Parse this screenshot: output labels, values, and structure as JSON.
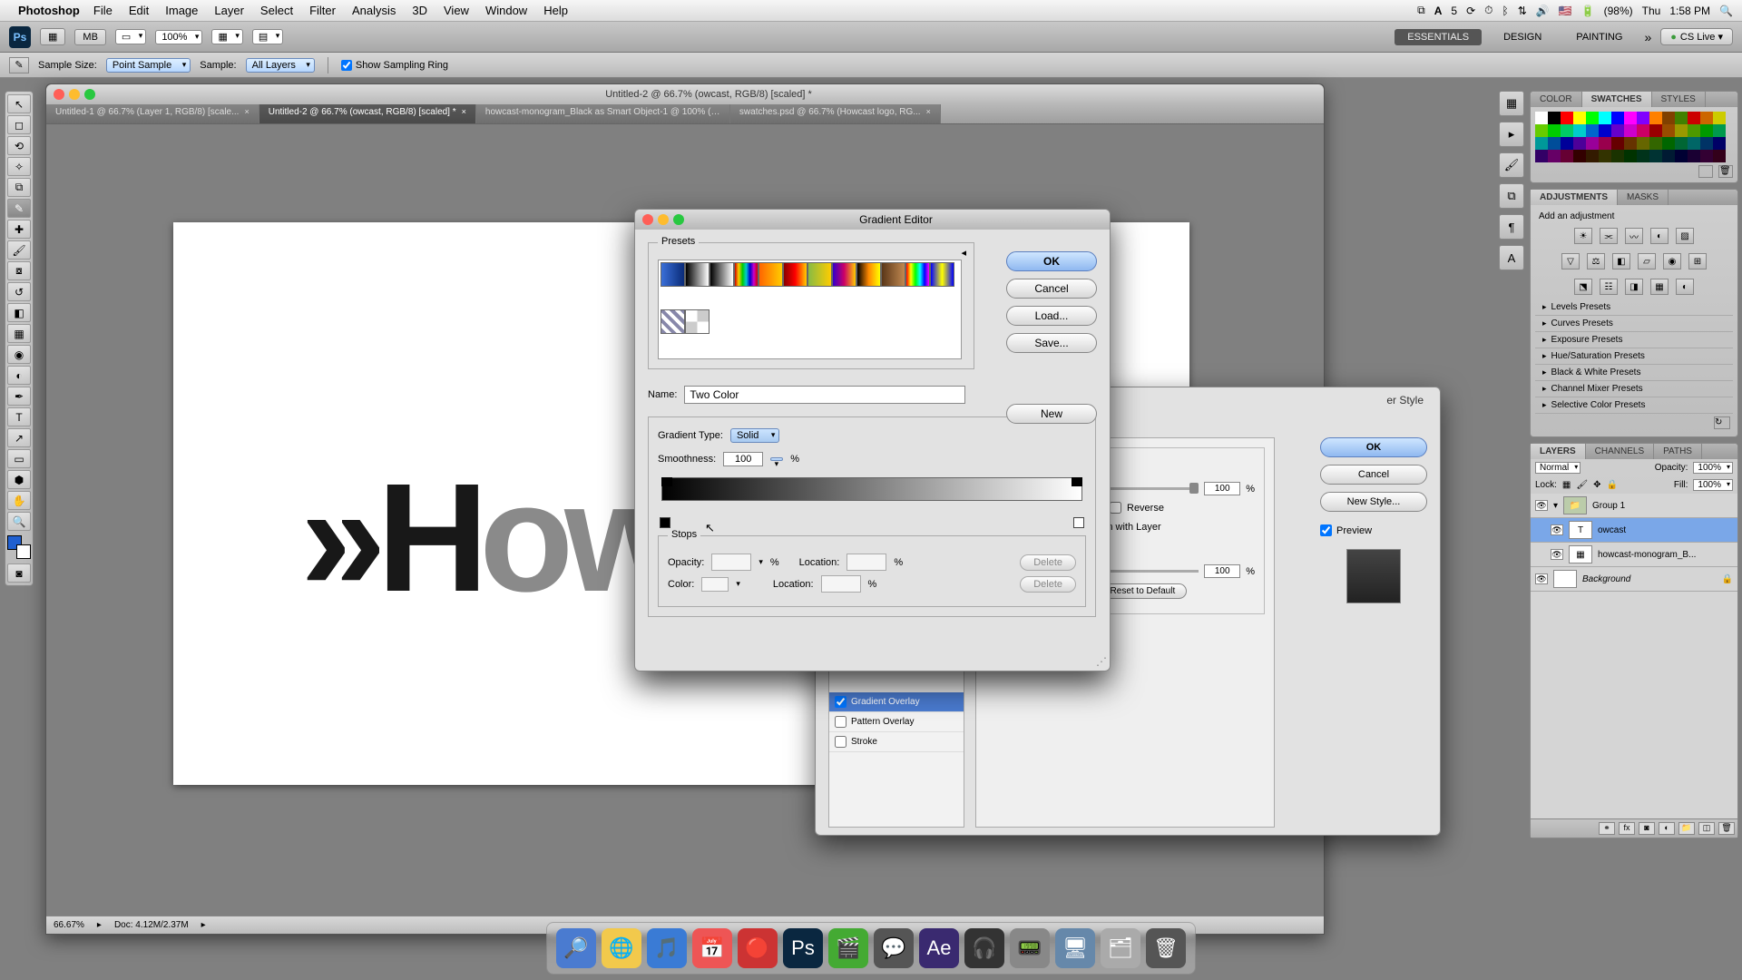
{
  "menubar": {
    "app": "Photoshop",
    "items": [
      "File",
      "Edit",
      "Image",
      "Layer",
      "Select",
      "Filter",
      "Analysis",
      "3D",
      "View",
      "Window",
      "Help"
    ],
    "right": {
      "battery": "(98%)",
      "day": "Thu",
      "time": "1:58 PM",
      "adobe": "5"
    }
  },
  "appbar": {
    "zoom": "100%",
    "tabs": {
      "essentials": "ESSENTIALS",
      "design": "DESIGN",
      "painting": "PAINTING"
    },
    "cslive": "CS Live"
  },
  "optbar": {
    "sample_size_label": "Sample Size:",
    "sample_size": "Point Sample",
    "sample_label": "Sample:",
    "sample": "All Layers",
    "show_ring": "Show Sampling Ring"
  },
  "docwin": {
    "title": "Untitled-2 @ 66.7% (owcast, RGB/8) [scaled] *",
    "tabs": [
      "Untitled-1 @ 66.7% (Layer 1, RGB/8) [scale...",
      "Untitled-2 @ 66.7% (owcast, RGB/8) [scaled] *",
      "howcast-monogram_Black as Smart Object-1 @ 100% (howcast-mon...",
      "swatches.psd @ 66.7% (Howcast logo, RG..."
    ],
    "status": {
      "zoom": "66.67%",
      "doc": "Doc: 4.12M/2.37M"
    }
  },
  "layerstyle": {
    "title": "er Style",
    "left": {
      "gradient_overlay": "Gradient Overlay",
      "pattern_overlay": "Pattern Overlay",
      "stroke": "Stroke"
    },
    "ok": "OK",
    "cancel": "Cancel",
    "newstyle": "New Style...",
    "preview": "Preview",
    "center": {
      "reverse": "Reverse",
      "align": "Align with Layer",
      "scale": "100",
      "angle": "100",
      "resetdef": "Reset to Default",
      "deg": "°",
      "pct": "%"
    }
  },
  "gradedit": {
    "title": "Gradient Editor",
    "presets": "Presets",
    "ok": "OK",
    "cancel": "Cancel",
    "load": "Load...",
    "save": "Save...",
    "new": "New",
    "name_label": "Name:",
    "name": "Two Color",
    "type_label": "Gradient Type:",
    "type": "Solid",
    "smooth_label": "Smoothness:",
    "smooth": "100",
    "pct": "%",
    "stops": "Stops",
    "opacity_label": "Opacity:",
    "location_label": "Location:",
    "color_label": "Color:",
    "delete": "Delete"
  },
  "panels": {
    "color": "COLOR",
    "swatches": "SWATCHES",
    "styles": "STYLES",
    "adjust": "ADJUSTMENTS",
    "masks": "MASKS",
    "add_adj": "Add an adjustment",
    "presets": [
      "Levels Presets",
      "Curves Presets",
      "Exposure Presets",
      "Hue/Saturation Presets",
      "Black & White Presets",
      "Channel Mixer Presets",
      "Selective Color Presets"
    ],
    "layers": "LAYERS",
    "channels": "CHANNELS",
    "paths": "PATHS",
    "blend": "Normal",
    "opacity_l": "Opacity:",
    "opacity": "100%",
    "lock": "Lock:",
    "fill_l": "Fill:",
    "fill": "100%",
    "layer_list": [
      {
        "name": "Group 1",
        "type": "group"
      },
      {
        "name": "owcast",
        "type": "text"
      },
      {
        "name": "howcast-monogram_B...",
        "type": "smart"
      },
      {
        "name": "Background",
        "type": "bg"
      }
    ]
  },
  "swatch_colors": [
    "#ffffff",
    "#000000",
    "#ff0000",
    "#ffff00",
    "#00ff00",
    "#00ffff",
    "#0000ff",
    "#ff00ff",
    "#8000ff",
    "#ff8000",
    "#804000",
    "#408000",
    "#cc0000",
    "#cc6600",
    "#cccc00",
    "#66cc00",
    "#00cc00",
    "#00cc66",
    "#00cccc",
    "#0066cc",
    "#0000cc",
    "#6600cc",
    "#cc00cc",
    "#cc0066",
    "#990000",
    "#994d00",
    "#999900",
    "#4d9900",
    "#009900",
    "#00994d",
    "#009999",
    "#004d99",
    "#000099",
    "#4d0099",
    "#990099",
    "#99004d",
    "#660000",
    "#663300",
    "#666600",
    "#336600",
    "#006600",
    "#006633",
    "#006666",
    "#003366",
    "#000066",
    "#330066",
    "#660066",
    "#660033",
    "#330000",
    "#331a00",
    "#333300",
    "#1a3300",
    "#003300",
    "#00331a",
    "#003333",
    "#001a33",
    "#000033",
    "#1a0033",
    "#330033",
    "#33001a"
  ],
  "gradient_presets": [
    "linear-gradient(90deg,#3a6fd8,#0a2b78)",
    "linear-gradient(90deg,#000,#fff)",
    "linear-gradient(90deg,#000,transparent)",
    "linear-gradient(90deg,#c00,#fc0,#0c0,#0cc,#00c,#c0c,#c00)",
    "linear-gradient(90deg,#f60,#fc0)",
    "linear-gradient(90deg,#800,#f00,#fc0)",
    "linear-gradient(90deg,#8b4,#fc0)",
    "linear-gradient(90deg,#30c,#c06,#fc0)",
    "linear-gradient(90deg,#000,#f80,#ff0)",
    "linear-gradient(90deg,#5a3618,#c08850)",
    "linear-gradient(90deg,#f00,#ff0,#0f0,#0ff,#00f,#f0f)",
    "linear-gradient(90deg,#00f,#ff0,#00f)",
    "repeating-linear-gradient(45deg,#88a 0 4px,#fff 4px 8px)",
    "repeating-conic-gradient(#ccc 0 25%,#fff 0 50%)"
  ],
  "dock": [
    "🔎",
    "🌐",
    "🎵",
    "📅",
    "🔴",
    "Ps",
    "🎬",
    "💬",
    "Ae",
    "🎧",
    "📟",
    "🖥",
    "🗂",
    "🗑"
  ]
}
